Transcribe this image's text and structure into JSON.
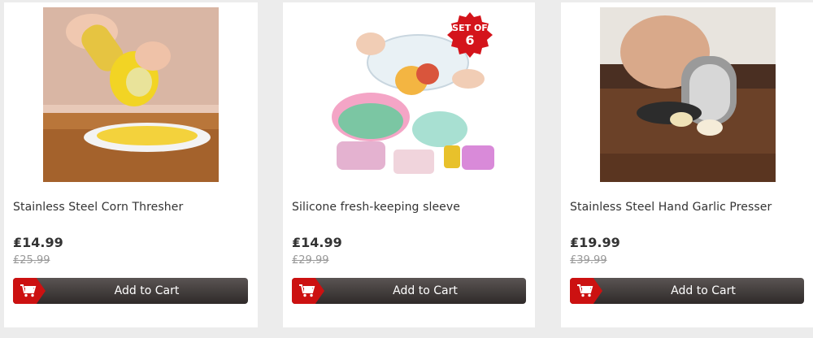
{
  "colors": {
    "accent": "#cc1111",
    "button": "#3b3534",
    "background": "#ececec"
  },
  "products": [
    {
      "title": "Stainless Steel Corn Thresher",
      "price": "₤14.99",
      "old_price": "₤25.99",
      "button_label": "Add to Cart",
      "image": "corn-thresher-photo"
    },
    {
      "title": "Silicone fresh-keeping sleeve",
      "price": "₤14.99",
      "old_price": "₤29.99",
      "button_label": "Add to Cart",
      "image": "silicone-lids-photo",
      "badge_line1": "SET OF",
      "badge_line2": "6"
    },
    {
      "title": "Stainless Steel Hand Garlic Presser",
      "price": "₤19.99",
      "old_price": "₤39.99",
      "button_label": "Add to Cart",
      "image": "garlic-presser-photo"
    }
  ]
}
